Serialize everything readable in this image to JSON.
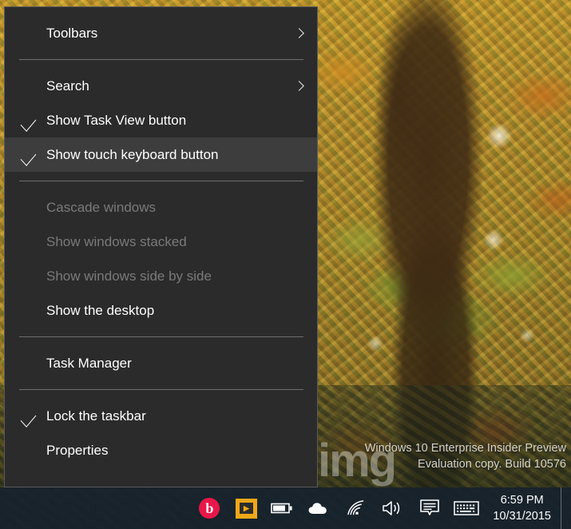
{
  "desktop": {
    "wallpaper_description": "autumn tree with golden and green leaves",
    "photo_watermark": "img",
    "eval_watermark": {
      "line1": "Windows 10 Enterprise Insider Preview",
      "line2": "Evaluation copy. Build 10576"
    }
  },
  "context_menu": {
    "name": "taskbar-context-menu",
    "background_color": "#2b2b2b",
    "border_color": "#5a5a5a",
    "highlight_color": "#3d3d3d",
    "items": [
      {
        "id": "toolbars",
        "label": "Toolbars",
        "checked": false,
        "submenu": true,
        "disabled": false,
        "highlighted": false
      },
      {
        "id": "search",
        "label": "Search",
        "checked": false,
        "submenu": true,
        "disabled": false,
        "highlighted": false
      },
      {
        "id": "task-view",
        "label": "Show Task View button",
        "checked": true,
        "submenu": false,
        "disabled": false,
        "highlighted": false
      },
      {
        "id": "touch-keyboard",
        "label": "Show touch keyboard button",
        "checked": true,
        "submenu": false,
        "disabled": false,
        "highlighted": true
      },
      {
        "id": "cascade",
        "label": "Cascade windows",
        "checked": false,
        "submenu": false,
        "disabled": true,
        "highlighted": false
      },
      {
        "id": "stacked",
        "label": "Show windows stacked",
        "checked": false,
        "submenu": false,
        "disabled": true,
        "highlighted": false
      },
      {
        "id": "side-by-side",
        "label": "Show windows side by side",
        "checked": false,
        "submenu": false,
        "disabled": true,
        "highlighted": false
      },
      {
        "id": "show-desktop",
        "label": "Show the desktop",
        "checked": false,
        "submenu": false,
        "disabled": false,
        "highlighted": false
      },
      {
        "id": "task-manager",
        "label": "Task Manager",
        "checked": false,
        "submenu": false,
        "disabled": false,
        "highlighted": false
      },
      {
        "id": "lock-taskbar",
        "label": "Lock the taskbar",
        "checked": true,
        "submenu": false,
        "disabled": false,
        "highlighted": false
      },
      {
        "id": "properties",
        "label": "Properties",
        "checked": false,
        "submenu": false,
        "disabled": false,
        "highlighted": false
      }
    ]
  },
  "taskbar": {
    "background_color": "#17222d",
    "tray_icons": [
      {
        "id": "beats-audio",
        "name": "beats-audio-icon",
        "glyph": "b"
      },
      {
        "id": "media-tile",
        "name": "media-tile-icon",
        "glyph": "▶",
        "color": "#f0a818"
      },
      {
        "id": "battery",
        "name": "battery-icon"
      },
      {
        "id": "onedrive",
        "name": "onedrive-cloud-icon"
      },
      {
        "id": "network",
        "name": "wifi-icon"
      },
      {
        "id": "volume",
        "name": "volume-speaker-icon"
      },
      {
        "id": "action-center",
        "name": "action-center-icon"
      },
      {
        "id": "touch-keyboard",
        "name": "touch-keyboard-icon"
      }
    ],
    "clock": {
      "time": "6:59 PM",
      "date": "10/31/2015"
    }
  }
}
